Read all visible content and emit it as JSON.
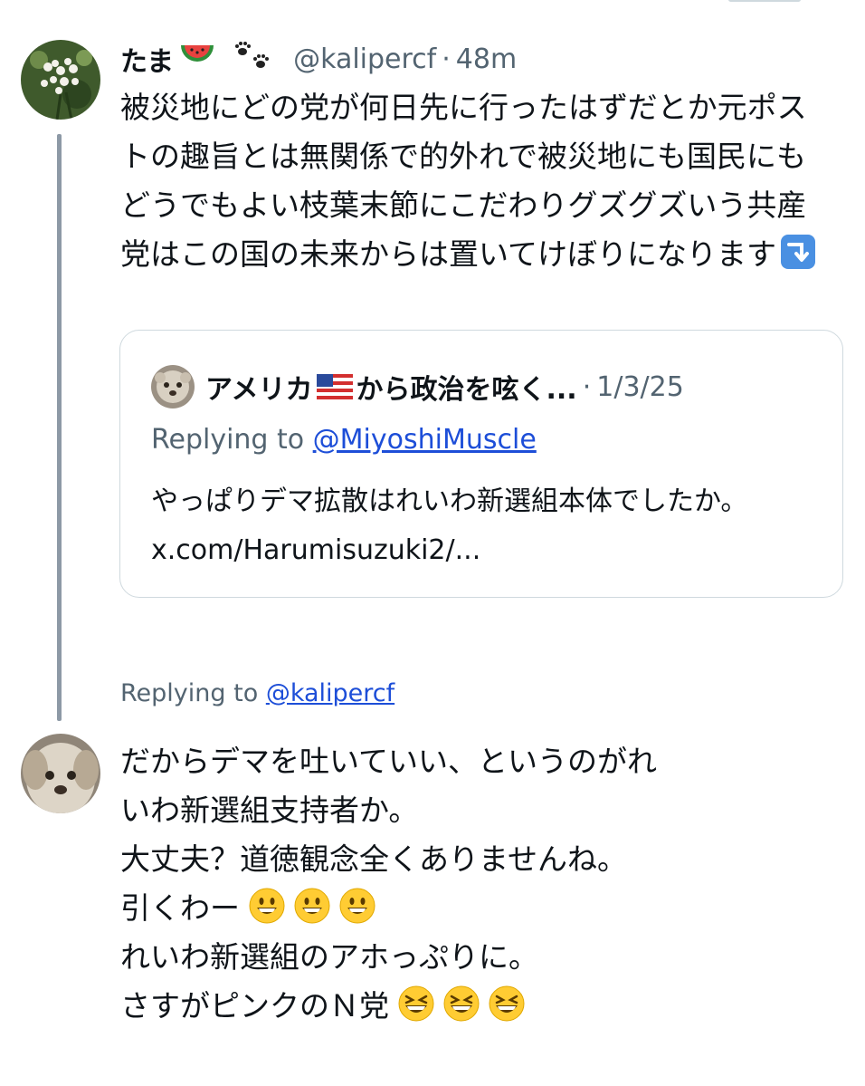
{
  "tweet": {
    "name": "たま",
    "handle": "@kalipercf",
    "separator": "·",
    "time": "48m",
    "text": "被災地にどの党が何日先に行ったはずだとか元ポストの趣旨とは無関係で的外れで被災地にも国民にもどうでもよい枝葉末節にこだわりグズグズいう共産党はこの国の未来からは置いてけぼりになります"
  },
  "quote": {
    "name_before": "アメリカ",
    "name_after": "から政治を呟く...",
    "separator": "·",
    "date": "1/3/25",
    "replying_prefix": "Replying to ",
    "replying_handle": "@MiyoshiMuscle",
    "text": "やっぱりデマ拡散はれいわ新選組本体でしたか。 x.com/Harumisuzuki2/..."
  },
  "reply": {
    "replying_prefix": "Replying to ",
    "replying_handle": "@kalipercf",
    "lines": [
      "だからデマを吐いていい、というのがれ",
      "いわ新選組支持者か。",
      "大丈夫？道徳観念全くありませんね。",
      "引くわー",
      "れいわ新選組のアホっぷりに。",
      "さすがピンクのＮ党"
    ]
  },
  "icons": {
    "name_emoji_1": "watermelon-icon",
    "name_emoji_2": "paw-prints-icon",
    "text_end": "arrow-down-right-icon",
    "flag": "us-flag-icon",
    "smile": "grinning-face-icon",
    "laugh": "laughing-face-icon"
  },
  "colors": {
    "text": "#0f1419",
    "secondary": "#536471",
    "link": "#1d4ed8",
    "border": "#cfd9de",
    "thread_line": "#8d99a6"
  }
}
